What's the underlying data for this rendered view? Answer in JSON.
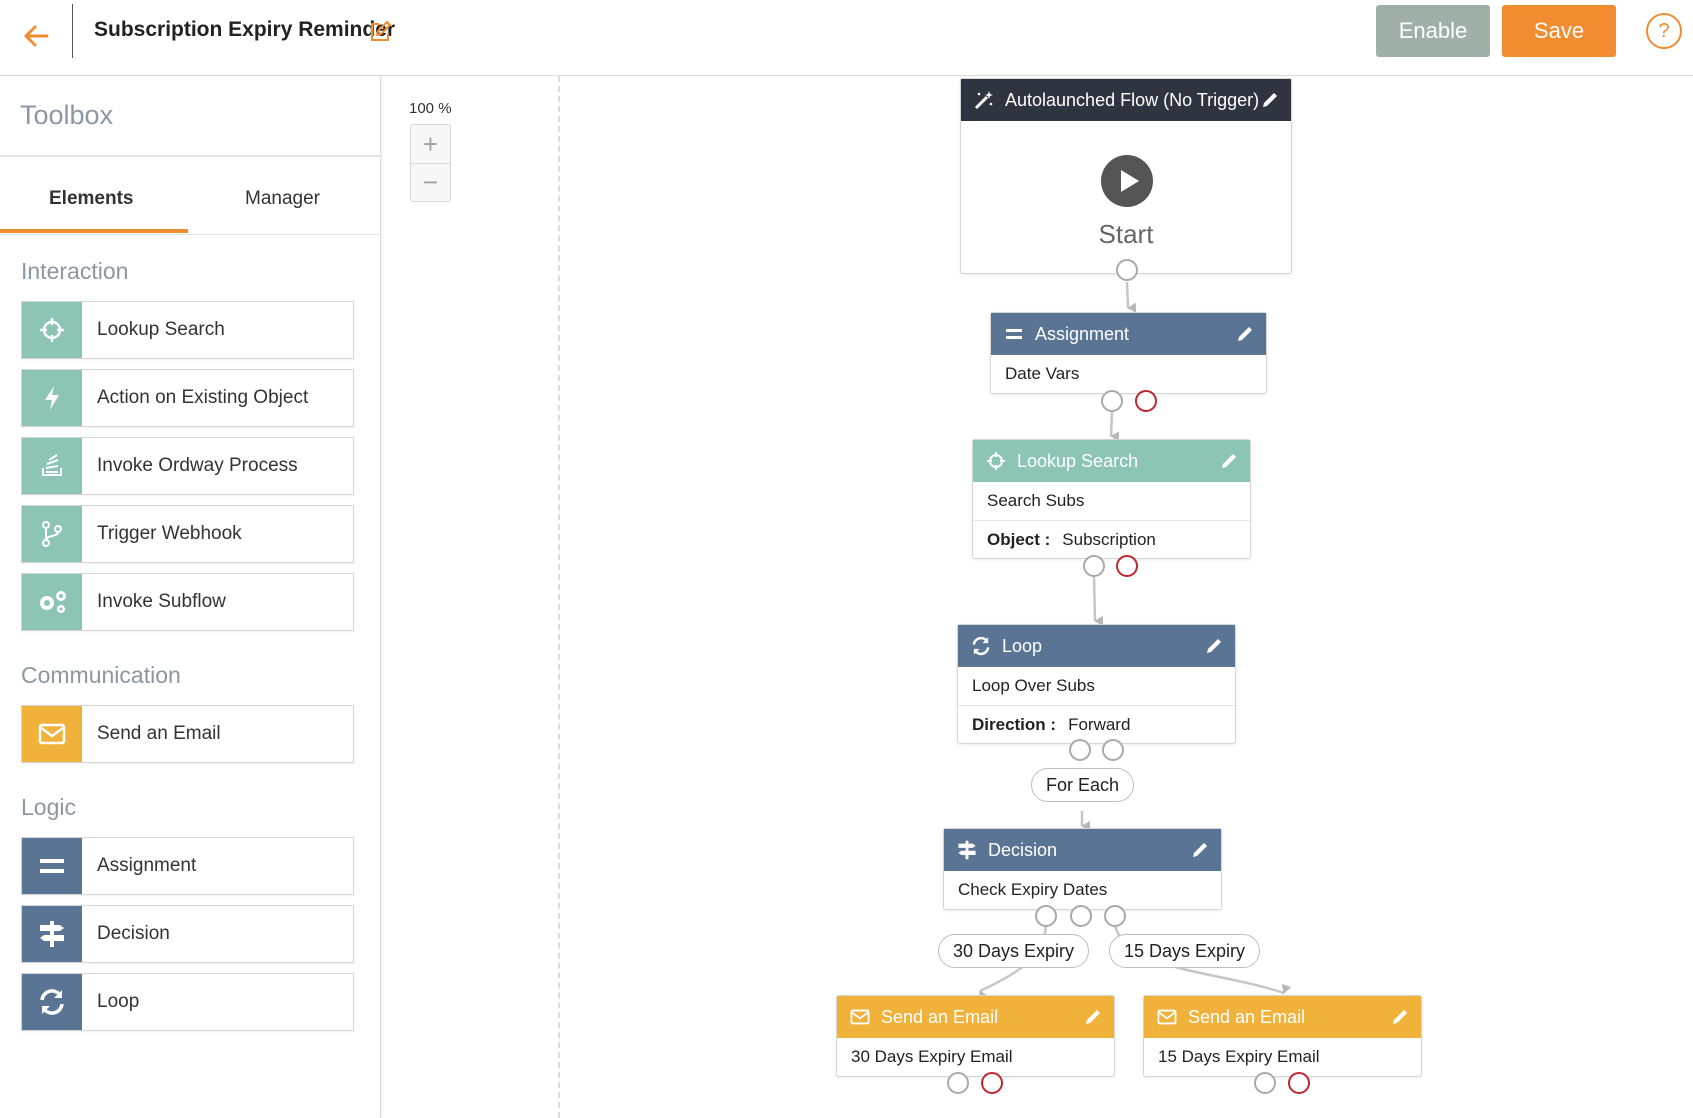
{
  "header": {
    "title": "Subscription Expiry Reminder",
    "enable_label": "Enable",
    "save_label": "Save",
    "help_label": "?"
  },
  "sidebar": {
    "title": "Toolbox",
    "tabs": [
      {
        "label": "Elements",
        "active": true
      },
      {
        "label": "Manager",
        "active": false
      }
    ],
    "sections": [
      {
        "title": "Interaction",
        "items": [
          {
            "label": "Lookup Search",
            "icon": "crosshair-icon",
            "color": "#8cc4b5"
          },
          {
            "label": "Action on Existing Object",
            "icon": "lightning-icon",
            "color": "#8cc4b5"
          },
          {
            "label": "Invoke Ordway Process",
            "icon": "process-stack-icon",
            "color": "#8cc4b5"
          },
          {
            "label": "Trigger Webhook",
            "icon": "branch-icon",
            "color": "#8cc4b5"
          },
          {
            "label": "Invoke Subflow",
            "icon": "gears-icon",
            "color": "#8cc4b5"
          }
        ]
      },
      {
        "title": "Communication",
        "items": [
          {
            "label": "Send an Email",
            "icon": "envelope-icon",
            "color": "#f0b23b"
          }
        ]
      },
      {
        "title": "Logic",
        "items": [
          {
            "label": "Assignment",
            "icon": "equals-icon",
            "color": "#5a7494"
          },
          {
            "label": "Decision",
            "icon": "signpost-icon",
            "color": "#5a7494"
          },
          {
            "label": "Loop",
            "icon": "refresh-icon",
            "color": "#5a7494"
          }
        ]
      }
    ]
  },
  "canvas": {
    "zoom": "100 %",
    "zoom_in": "+",
    "zoom_out": "−",
    "nodes": {
      "start": {
        "header": "Autolaunched Flow (No Trigger)",
        "label": "Start"
      },
      "assignment": {
        "header": "Assignment",
        "name": "Date Vars"
      },
      "lookup": {
        "header": "Lookup Search",
        "name": "Search Subs",
        "field_key": "Object :",
        "field_value": "Subscription"
      },
      "loop": {
        "header": "Loop",
        "name": "Loop Over Subs",
        "field_key": "Direction :",
        "field_value": "Forward"
      },
      "decision": {
        "header": "Decision",
        "name": "Check Expiry Dates"
      },
      "email30": {
        "header": "Send an Email",
        "name": "30 Days Expiry Email"
      },
      "email15": {
        "header": "Send an Email",
        "name": "15 Days Expiry Email"
      }
    },
    "labels": {
      "for_each": "For Each",
      "days30": "30 Days Expiry",
      "days15": "15 Days Expiry"
    }
  },
  "colors": {
    "accent": "#f28c30",
    "interaction": "#8cc4b5",
    "communication": "#f0b23b",
    "logic": "#5a7494",
    "trigger_header": "#2f3540",
    "fault_port": "#c0262d"
  }
}
